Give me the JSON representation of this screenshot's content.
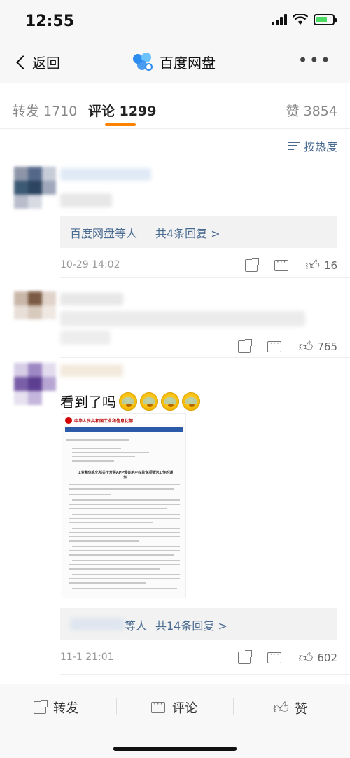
{
  "status_bar": {
    "time": "12:55",
    "battery_charging": true
  },
  "nav": {
    "back_label": "返回",
    "title": "百度网盘",
    "more_icon": "more-dots-icon"
  },
  "tabs": [
    {
      "label": "转发 1710",
      "active": false
    },
    {
      "label": "评论 1299",
      "active": true
    },
    {
      "label": "赞 3854",
      "active": false
    }
  ],
  "sort": {
    "label": "按热度"
  },
  "comments": [
    {
      "reply_summary": {
        "who": "百度网盘等人",
        "more": "共4条回复 >"
      },
      "time": "10-29 14:02",
      "likes": "16"
    },
    {
      "likes": "765"
    },
    {
      "text": "看到了吗",
      "image_doc": {
        "header": "中华人民共和国工业和信息化部",
        "title": "工业和信息化部关于开展APP侵害用户权益专项整治工作的通知"
      },
      "reply_summary": {
        "who": "等人",
        "more": "共14条回复 >"
      },
      "time": "11-1 21:01",
      "likes": "602"
    }
  ],
  "bottom_bar": {
    "repost": "转发",
    "comment": "评论",
    "like": "赞"
  },
  "colors": {
    "accent": "#ff8200",
    "link": "#4a6b91"
  }
}
